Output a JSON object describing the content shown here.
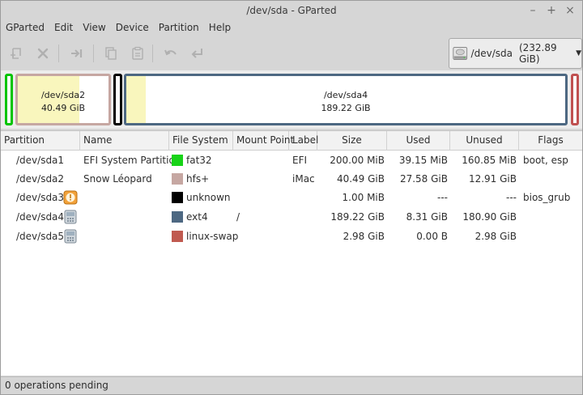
{
  "window": {
    "title": "/dev/sda - GParted",
    "controls": [
      "–",
      "+",
      "×"
    ]
  },
  "menubar": {
    "items": [
      "GParted",
      "Edit",
      "View",
      "Device",
      "Partition",
      "Help"
    ]
  },
  "toolbar": {
    "icons": [
      "new-partition-icon",
      "delete-icon",
      "resize-move-icon",
      "copy-icon",
      "paste-icon",
      "undo-icon",
      "apply-icon"
    ]
  },
  "device_selector": {
    "device": "/dev/sda",
    "size": "(232.89 GiB)",
    "arrow": "▼"
  },
  "partition_map": [
    {
      "name": "",
      "size": "",
      "border_color": "#00c400",
      "used_fraction": 0.0
    },
    {
      "name": "/dev/sda2",
      "size": "40.49 GiB",
      "border_color": "#c6a7a2",
      "used_fraction": 0.68
    },
    {
      "name": "",
      "size": "",
      "border_color": "#000000",
      "used_fraction": 0.0
    },
    {
      "name": "/dev/sda4",
      "size": "189.22 GiB",
      "border_color": "#4d6882",
      "used_fraction": 0.044
    },
    {
      "name": "",
      "size": "",
      "border_color": "#c05050",
      "used_fraction": 0.0
    }
  ],
  "table": {
    "columns": [
      "Partition",
      "Name",
      "File System",
      "Mount Point",
      "Label",
      "Size",
      "Used",
      "Unused",
      "Flags"
    ],
    "rows": [
      {
        "partition": "/dev/sda1",
        "status_icon": "",
        "name": "EFI System Partition",
        "fs": "fat32",
        "fs_color": "#18d318",
        "mount": "",
        "label": "EFI",
        "size": "200.00 MiB",
        "used": "39.15 MiB",
        "unused": "160.85 MiB",
        "flags": "boot, esp"
      },
      {
        "partition": "/dev/sda2",
        "status_icon": "",
        "name": "Snow Léopard",
        "fs": "hfs+",
        "fs_color": "#c6a7a2",
        "mount": "",
        "label": "iMac",
        "size": "40.49 GiB",
        "used": "27.58 GiB",
        "unused": "12.91 GiB",
        "flags": ""
      },
      {
        "partition": "/dev/sda3",
        "status_icon": "warning-icon",
        "name": "",
        "fs": "unknown",
        "fs_color": "#000000",
        "mount": "",
        "label": "",
        "size": "1.00 MiB",
        "used": "---",
        "unused": "---",
        "flags": "bios_grub"
      },
      {
        "partition": "/dev/sda4",
        "status_icon": "lock-icon",
        "name": "",
        "fs": "ext4",
        "fs_color": "#4d6882",
        "mount": "/",
        "label": "",
        "size": "189.22 GiB",
        "used": "8.31 GiB",
        "unused": "180.90 GiB",
        "flags": ""
      },
      {
        "partition": "/dev/sda5",
        "status_icon": "lock-icon",
        "name": "",
        "fs": "linux-swap",
        "fs_color": "#c05a50",
        "mount": "",
        "label": "",
        "size": "2.98 GiB",
        "used": "0.00 B",
        "unused": "2.98 GiB",
        "flags": ""
      }
    ]
  },
  "statusbar": {
    "text": "0 operations pending"
  }
}
